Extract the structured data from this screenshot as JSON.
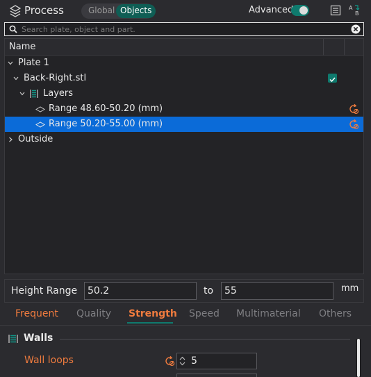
{
  "header": {
    "title": "Process",
    "mode_options": [
      "Global",
      "Objects"
    ],
    "selected_mode": "Objects",
    "advanced_label": "Advanced",
    "advanced_on": true
  },
  "search": {
    "placeholder": "Search plate, object and part."
  },
  "tree": {
    "column_name": "Name",
    "rows": [
      {
        "label": "Plate 1",
        "expanded": true
      },
      {
        "label": "Back-Right.stl",
        "expanded": true,
        "checked": true
      },
      {
        "label": "Layers",
        "expanded": true
      },
      {
        "label": "Range 48.60-50.20 (mm)"
      },
      {
        "label": "Range 50.20-55.00 (mm)",
        "selected": true
      },
      {
        "label": "Outside",
        "expanded": false
      }
    ]
  },
  "height_range": {
    "label": "Height Range",
    "from": "50.2",
    "to_label": "to",
    "to": "55",
    "unit": "mm"
  },
  "tabs": {
    "items": [
      "Frequent",
      "Quality",
      "Strength",
      "Speed",
      "Multimaterial",
      "Others"
    ],
    "active": "Strength"
  },
  "settings": {
    "group_title": "Walls",
    "wall_loops_label": "Wall loops",
    "wall_loops_value": "5"
  },
  "colors": {
    "accent": "#0f7a6e",
    "modified": "#ef7b3e",
    "selection": "#0b6bd8",
    "background": "#2b2b2f"
  },
  "icons": [
    "process-icon",
    "list-icon",
    "compare-icon",
    "search-icon",
    "clear-icon",
    "layers-icon",
    "range-icon",
    "reset-icon",
    "walls-icon"
  ]
}
